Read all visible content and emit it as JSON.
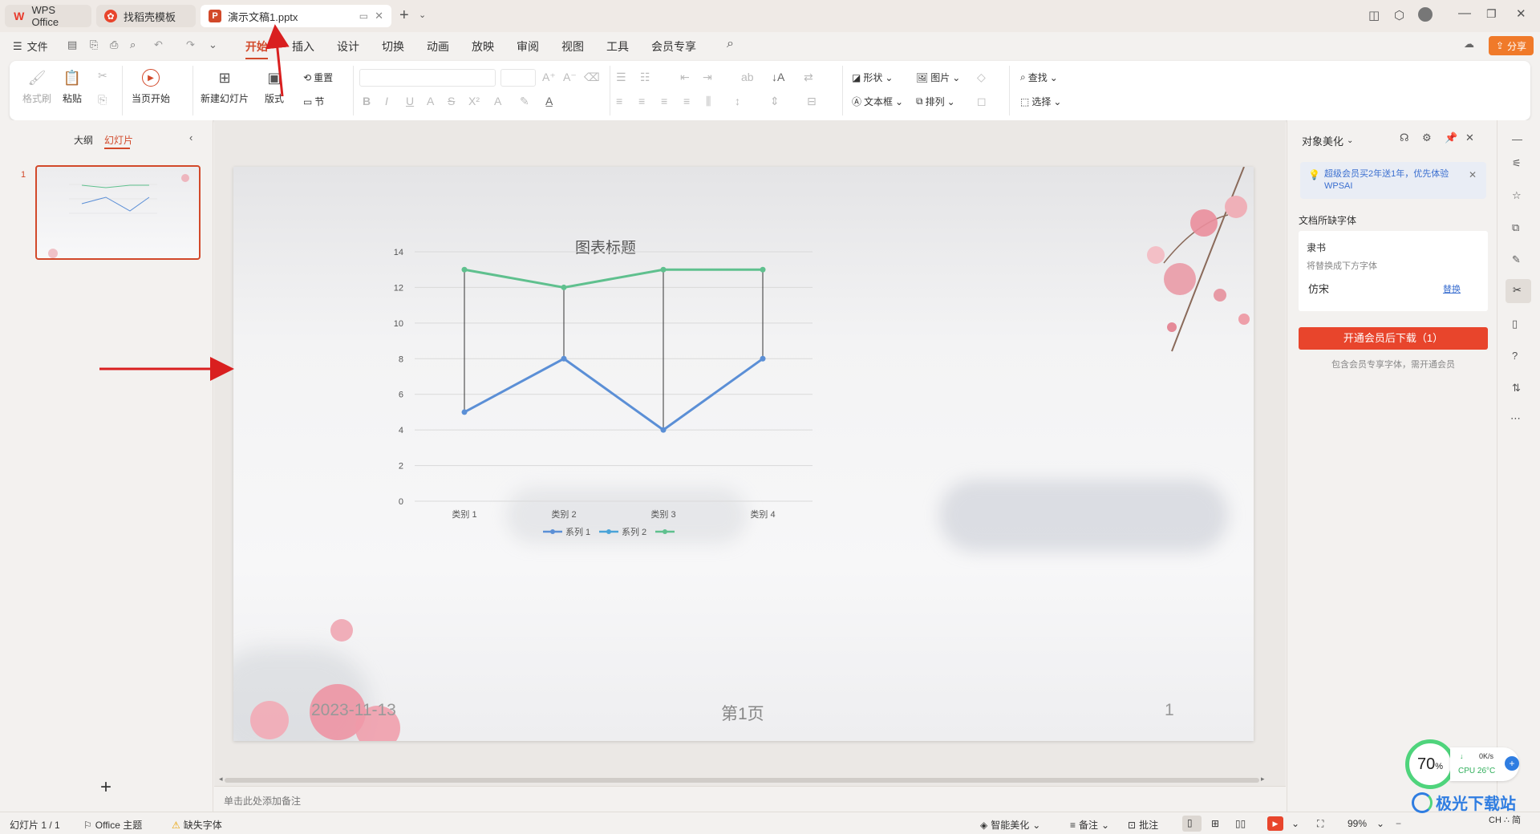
{
  "tabs": [
    {
      "label": "WPS Office"
    },
    {
      "label": "找稻壳模板"
    },
    {
      "label": "演示文稿1.pptx"
    }
  ],
  "menu": {
    "file": "文件",
    "items": [
      "开始",
      "插入",
      "设计",
      "切换",
      "动画",
      "放映",
      "审阅",
      "视图",
      "工具",
      "会员专享"
    ],
    "share": "分享"
  },
  "ribbon": {
    "format_painter": "格式刷",
    "paste": "粘贴",
    "play_from_current": "当页开始",
    "new_slide": "新建幻灯片",
    "layout": "版式",
    "reset": "重置",
    "section": "节",
    "shape": "形状",
    "picture": "图片",
    "textbox": "文本框",
    "arrange": "排列",
    "find": "查找",
    "select": "选择"
  },
  "left_panel": {
    "outline_tab": "大纲",
    "slides_tab": "幻灯片",
    "slide_number": "1",
    "add": "+"
  },
  "slide": {
    "date": "2023-11-13",
    "page_label": "第1页",
    "page_number": "1"
  },
  "chart_data": {
    "type": "line",
    "title": "图表标题",
    "categories": [
      "类别 1",
      "类别 2",
      "类别 3",
      "类别 4"
    ],
    "series": [
      {
        "name": "系列 1",
        "values": [
          5,
          8,
          4,
          8
        ],
        "color": "#5b8fd6"
      },
      {
        "name": "系列 2",
        "values": [
          null,
          null,
          null,
          null
        ],
        "color": "#4aa3d8"
      },
      {
        "name": "",
        "values": [
          13,
          12,
          13,
          13
        ],
        "color": "#5fc08e"
      }
    ],
    "ylim": [
      0,
      14
    ],
    "yticks": [
      0,
      2,
      4,
      6,
      8,
      10,
      12,
      14
    ],
    "grid": true,
    "drop_lines": true,
    "legend": "bottom"
  },
  "notes_placeholder": "单击此处添加备注",
  "right_panel": {
    "title": "对象美化",
    "promo": "超级会员买2年送1年，优先体验WPSAI",
    "missing_fonts_heading": "文档所缺字体",
    "missing_font": "隶书",
    "replace_hint": "将替换成下方字体",
    "replacement_font": "仿宋",
    "replace_link": "替换",
    "download_button": "开通会员后下载（1）",
    "footnote": "包含会员专享字体，需开通会员"
  },
  "status": {
    "slide_info": "幻灯片 1 / 1",
    "theme": "Office 主题",
    "missing_font": "缺失字体",
    "smart_beautify": "智能美化",
    "notes": "备注",
    "comments": "批注",
    "zoom": "99%"
  },
  "overlay": {
    "percent": "70",
    "percent_sign": "%",
    "net": "0K/s",
    "cpu": "CPU 26°C",
    "watermark": "极光下载站",
    "ime": "CH ∴ 简"
  },
  "colors": {
    "accent": "#d2492a",
    "red_button": "#e8452c",
    "arrow": "#d91f1f"
  }
}
